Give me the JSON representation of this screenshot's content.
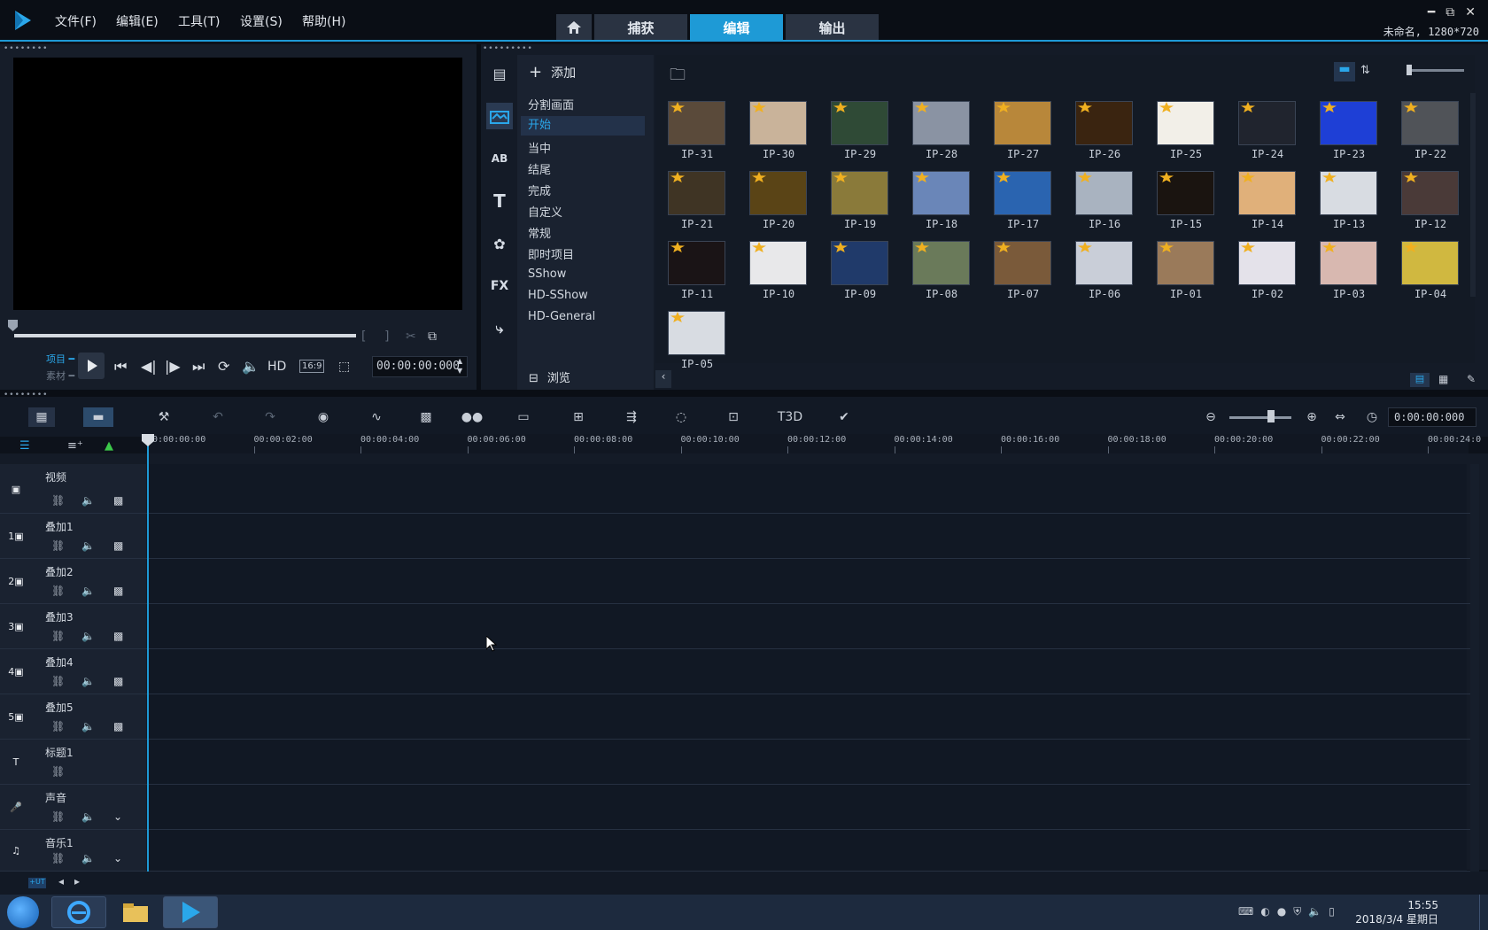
{
  "menu": [
    {
      "label": "文件(F)"
    },
    {
      "label": "编辑(E)"
    },
    {
      "label": "工具(T)"
    },
    {
      "label": "设置(S)"
    },
    {
      "label": "帮助(H)"
    }
  ],
  "tabs": {
    "capture": "捕获",
    "edit": "编辑",
    "output": "输出"
  },
  "window_controls": {
    "minimize": "━",
    "restore": "⧉",
    "close": "✕"
  },
  "project_info": "未命名, 1280*720",
  "player": {
    "mode_project": "项目",
    "mode_clip": "素材",
    "hd_label": "HD",
    "aspect_label": "16:9",
    "timecode": "00:00:00:000"
  },
  "library": {
    "add_label": "添加",
    "browse_label": "浏览",
    "fx_label": "FX",
    "categories": [
      "分割画面",
      "开始",
      "当中",
      "结尾",
      "完成",
      "自定义",
      "常规",
      "即时项目",
      "SShow",
      "HD-SShow",
      "HD-General"
    ],
    "active_category": "开始",
    "thumbnails": [
      "IP-31",
      "IP-30",
      "IP-29",
      "IP-28",
      "IP-27",
      "IP-26",
      "IP-25",
      "IP-24",
      "IP-23",
      "IP-22",
      "IP-21",
      "IP-20",
      "IP-19",
      "IP-18",
      "IP-17",
      "IP-16",
      "IP-15",
      "IP-14",
      "IP-13",
      "IP-12",
      "IP-11",
      "IP-10",
      "IP-09",
      "IP-08",
      "IP-07",
      "IP-06",
      "IP-01",
      "IP-02",
      "IP-03",
      "IP-04",
      "IP-05"
    ],
    "thumb_colors": [
      "#5a4a3a",
      "#c9b39a",
      "#2f4a36",
      "#8a93a3",
      "#b8873a",
      "#3a2410",
      "#f2efe8",
      "#20242e",
      "#1e3fd6",
      "#505358",
      "#3f3424",
      "#5a4416",
      "#8a7a3a",
      "#6a86b8",
      "#2a64b0",
      "#a9b3c0",
      "#1a1410",
      "#e0b07a",
      "#d8dce2",
      "#4a3a38",
      "#1a1416",
      "#e8e8ea",
      "#203a6a",
      "#6a7a5a",
      "#7a5a3a",
      "#c9ced8",
      "#9a7a5a",
      "#e4e2ea",
      "#d8b8b0",
      "#d0b840",
      "#d8dce2"
    ]
  },
  "timeline": {
    "timecode": "0:00:00:000",
    "ruler_ticks": [
      "00:00:00:00",
      "00:00:02:00",
      "00:00:04:00",
      "00:00:06:00",
      "00:00:08:00",
      "00:00:10:00",
      "00:00:12:00",
      "00:00:14:00",
      "00:00:16:00",
      "00:00:18:00",
      "00:00:20:00",
      "00:00:22:00",
      "00:00:24:0"
    ],
    "tracks": [
      {
        "name": "视频",
        "icon": "video",
        "badge": ""
      },
      {
        "name": "叠加1",
        "icon": "overlay",
        "badge": "1"
      },
      {
        "name": "叠加2",
        "icon": "overlay",
        "badge": "2"
      },
      {
        "name": "叠加3",
        "icon": "overlay",
        "badge": "3"
      },
      {
        "name": "叠加4",
        "icon": "overlay",
        "badge": "4"
      },
      {
        "name": "叠加5",
        "icon": "overlay",
        "badge": "5"
      },
      {
        "name": "标题1",
        "icon": "title",
        "badge": "T"
      },
      {
        "name": "声音",
        "icon": "voice",
        "badge": ""
      },
      {
        "name": "音乐1",
        "icon": "music",
        "badge": ""
      }
    ]
  },
  "taskbar": {
    "time": "15:55",
    "date": "2018/3/4 星期日"
  }
}
